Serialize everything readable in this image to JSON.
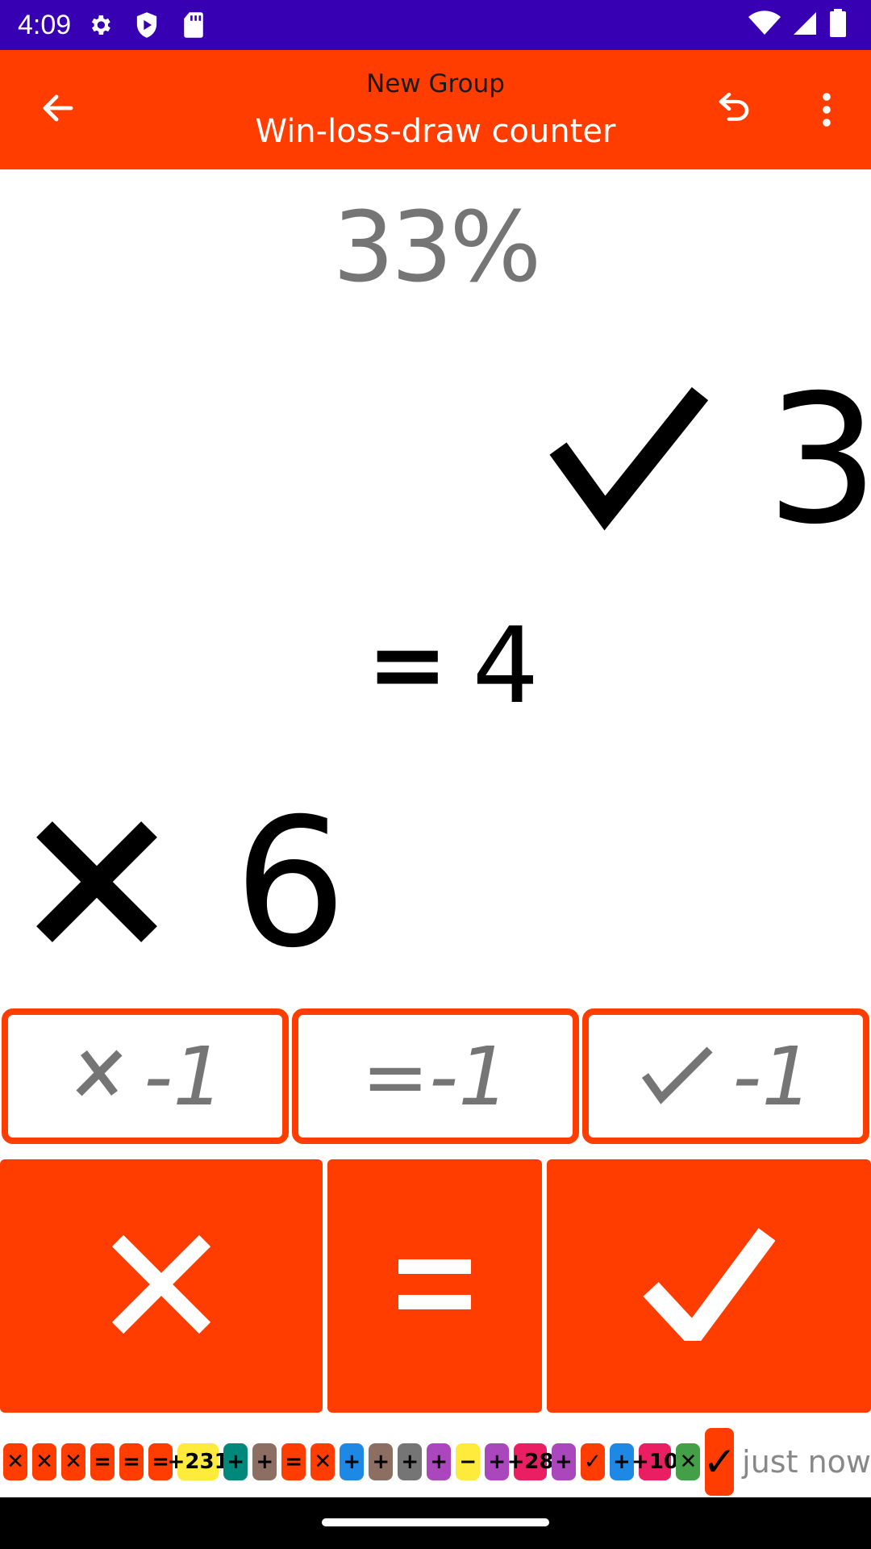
{
  "status_bar": {
    "time": "4:09",
    "icons": [
      "gear-icon",
      "shield-icon",
      "sdcard-icon",
      "wifi-icon",
      "signal-icon",
      "battery-icon"
    ]
  },
  "app_bar": {
    "subtitle": "New Group",
    "title": "Win-loss-draw counter",
    "icons": [
      "back-arrow-icon",
      "undo-icon",
      "more-vert-icon"
    ]
  },
  "display": {
    "percent": "33%",
    "wins": "3",
    "draws": "4",
    "losses": "6",
    "draw_symbol": "="
  },
  "decrement_buttons": {
    "loss_label": "-1",
    "draw_label": "=-1",
    "win_label": "-1"
  },
  "history": {
    "chips": [
      {
        "label": "✕",
        "color": "#ff3d00"
      },
      {
        "label": "✕",
        "color": "#ff3d00"
      },
      {
        "label": "✕",
        "color": "#ff3d00"
      },
      {
        "label": "=",
        "color": "#ff3d00"
      },
      {
        "label": "=",
        "color": "#ff3d00"
      },
      {
        "label": "=",
        "color": "#ff3d00"
      },
      {
        "label": "+231",
        "color": "#ffeb3b"
      },
      {
        "label": "+",
        "color": "#00897b"
      },
      {
        "label": "+",
        "color": "#8d6e63"
      },
      {
        "label": "=",
        "color": "#ff3d00"
      },
      {
        "label": "✕",
        "color": "#ff3d00"
      },
      {
        "label": "+",
        "color": "#1e88e5"
      },
      {
        "label": "+",
        "color": "#8d6e63"
      },
      {
        "label": "+",
        "color": "#757575"
      },
      {
        "label": "+",
        "color": "#ab47bc"
      },
      {
        "label": "−",
        "color": "#ffeb3b"
      },
      {
        "label": "+",
        "color": "#ab47bc"
      },
      {
        "label": "+28",
        "color": "#e91e63"
      },
      {
        "label": "+",
        "color": "#ab47bc"
      },
      {
        "label": "✓",
        "color": "#ff3d00"
      },
      {
        "label": "+",
        "color": "#1e88e5"
      },
      {
        "label": "+10",
        "color": "#e91e63"
      },
      {
        "label": "✕",
        "color": "#43a047"
      }
    ],
    "last_chip": {
      "label": "✓",
      "color": "#ff3d00"
    },
    "timestamp": "just now"
  },
  "colors": {
    "accent": "#ff3d00",
    "status_bar": "#3700b3"
  }
}
